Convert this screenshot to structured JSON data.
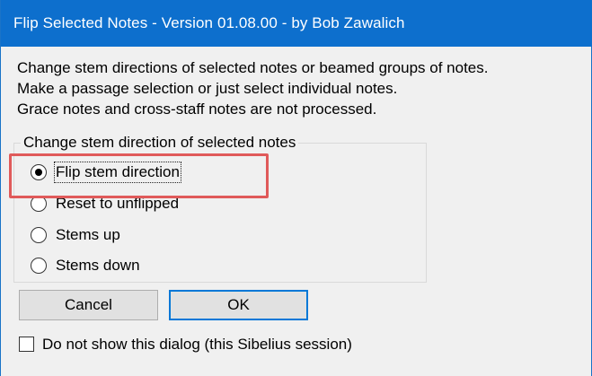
{
  "window": {
    "title": "Flip Selected Notes - Version 01.08.00 - by Bob Zawalich"
  },
  "description": {
    "line1": "Change stem directions of selected notes or beamed groups of notes.",
    "line2": "Make a passage selection or just select individual notes.",
    "line3": "Grace notes and cross-staff notes are not processed."
  },
  "group": {
    "label": "Change stem direction of selected notes",
    "options": [
      {
        "label": "Flip stem direction",
        "selected": true
      },
      {
        "label": "Reset to unflipped",
        "selected": false
      },
      {
        "label": "Stems up",
        "selected": false
      },
      {
        "label": "Stems down",
        "selected": false
      }
    ]
  },
  "buttons": {
    "cancel": "Cancel",
    "ok": "OK"
  },
  "checkbox": {
    "label": "Do not show this dialog (this Sibelius session)",
    "checked": false
  },
  "colors": {
    "titlebar": "#0d6fcd",
    "highlight": "#e05a5a",
    "ok_border": "#0078d7"
  }
}
